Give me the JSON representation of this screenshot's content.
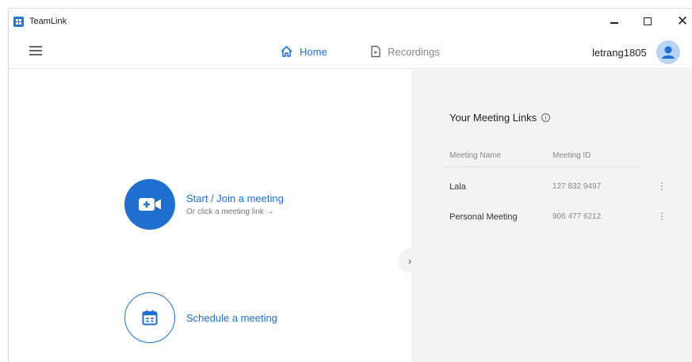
{
  "window": {
    "title": "TeamLink",
    "minimize_glyph": "−",
    "close_glyph": "✕"
  },
  "nav": {
    "home_label": "Home",
    "recordings_label": "Recordings",
    "active_tab": "Home",
    "username": "letrang1805"
  },
  "actions": {
    "start_title": "Start / Join a meeting",
    "start_sub": "Or click a meeting link →",
    "schedule_title": "Schedule a meeting"
  },
  "meeting_links": {
    "title": "Your Meeting Links",
    "columns": [
      "Meeting Name",
      "Meeting ID"
    ],
    "rows": [
      {
        "name": "Lala",
        "id": "127 832 9497"
      },
      {
        "name": "Personal Meeting",
        "id": "906 477 6212"
      }
    ]
  },
  "icons": {
    "hamburger": "hamburger-icon",
    "home": "home-icon",
    "recordings": "recording-file-icon",
    "avatar": "user-avatar-icon",
    "start": "video-camera-plus-icon",
    "schedule": "calendar-icon",
    "collapse": "chevron-right-icon",
    "info": "info-icon",
    "more": "more-vertical-icon"
  },
  "colors": {
    "accent": "#1e6fd0",
    "panel_bg": "#f3f3f3",
    "avatar_bg": "#b9d3f2"
  }
}
